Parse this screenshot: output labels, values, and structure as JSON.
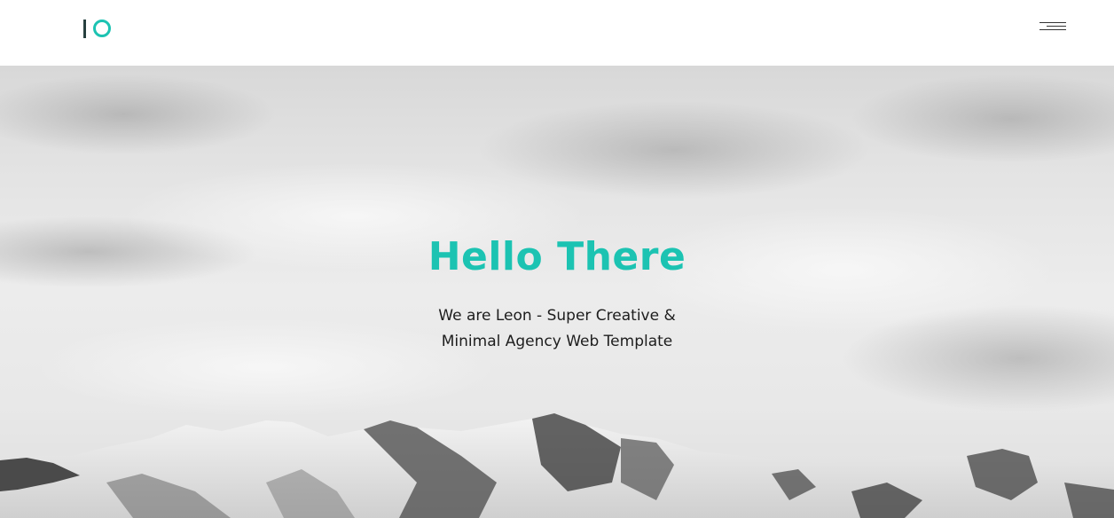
{
  "header": {
    "logo": {
      "name": "logo-icon",
      "accent": "#1cc3b2",
      "dark": "#27403f"
    },
    "menu": {
      "icon": "hamburger-icon"
    }
  },
  "hero": {
    "title": "Hello There",
    "subtitle_line1": "We are Leon - Super Creative &",
    "subtitle_line2": "Minimal Agency Web Template",
    "background": "snowy-mountains-photo",
    "title_color": "#1cc3b2"
  }
}
